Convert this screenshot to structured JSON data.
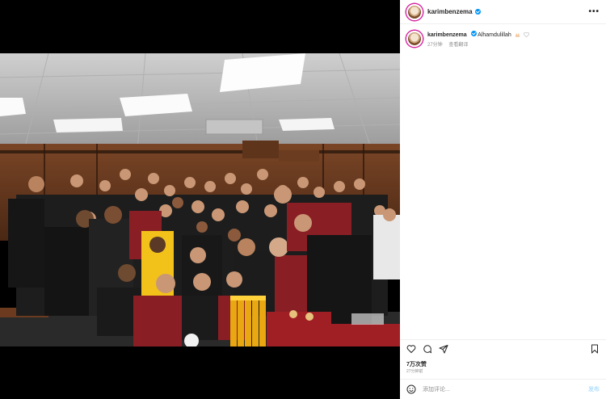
{
  "post": {
    "username": "karimbenzema",
    "caption_username": "karimbenzema",
    "caption_text": "Alhamdulillah",
    "caption_time": "27分钟",
    "translate_label": "查看翻译",
    "likes": "7万次赞",
    "time_ago": "27分钟前",
    "comment_placeholder": "添加评论...",
    "post_label": "发布"
  },
  "icons": {
    "more": "more-options-icon",
    "verified": "verified-badge-icon",
    "like": "heart-icon",
    "comment": "comment-icon",
    "share": "share-icon",
    "save": "bookmark-icon",
    "emoji": "smiley-icon"
  },
  "colors": {
    "accent": "#0095f6",
    "jersey_dark": "#1a1a1a",
    "jersey_red": "#8a1e25",
    "jersey_yellow": "#f2c21b"
  }
}
